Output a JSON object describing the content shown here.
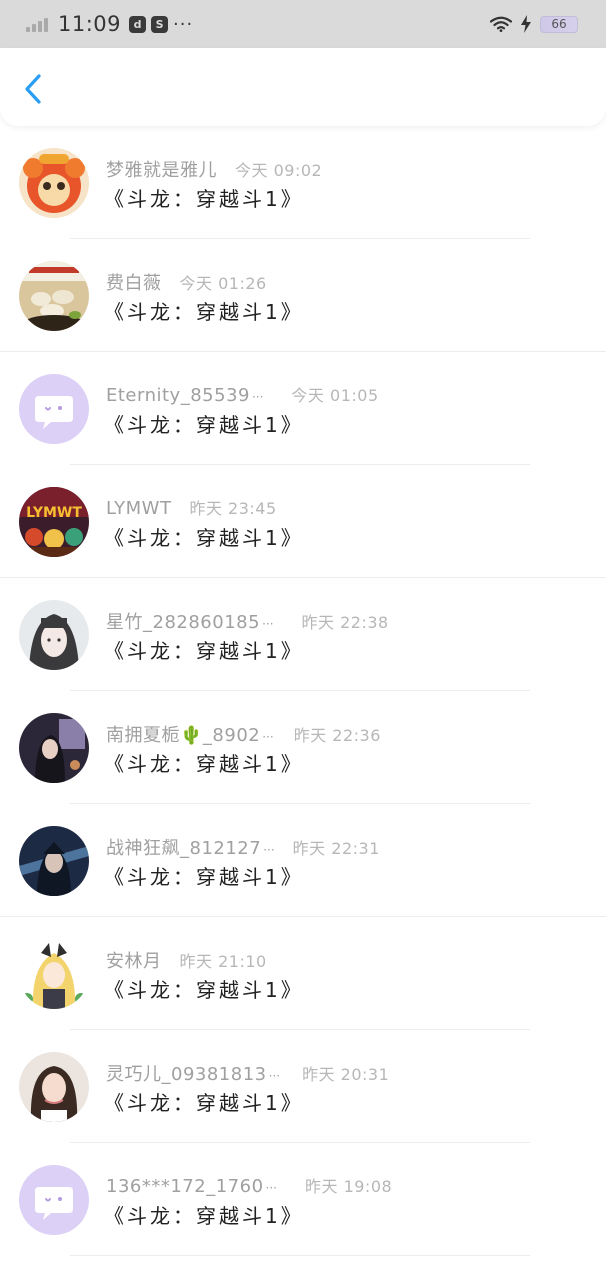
{
  "status_bar": {
    "time": "11:09",
    "icon_a": "d",
    "icon_b": "S",
    "more": "···",
    "battery": "66"
  },
  "header": {
    "back_icon": "chevron-left-icon"
  },
  "accent_color": "#2a9df4",
  "rows": [
    {
      "name": "梦雅就是雅儿",
      "truncated": "",
      "time": "今天 09:02",
      "book": "《斗龙：穿越斗1》",
      "avatar": "orange"
    },
    {
      "name": "费白薇",
      "truncated": "",
      "time": "今天 01:26",
      "book": "《斗龙：穿越斗1》",
      "avatar": "food"
    },
    {
      "name": "Eternity_85539",
      "truncated": "···",
      "time": "今天 01:05",
      "book": "《斗龙：穿越斗1》",
      "avatar": "default"
    },
    {
      "name": "LYMWT",
      "truncated": "",
      "time": "昨天 23:45",
      "book": "《斗龙：穿越斗1》",
      "avatar": "game"
    },
    {
      "name": "星竹_282860185",
      "truncated": "···",
      "time": "昨天 22:38",
      "book": "《斗龙：穿越斗1》",
      "avatar": "girl"
    },
    {
      "name": "南拥夏栀🌵_8902",
      "truncated": "···",
      "time": "昨天 22:36",
      "book": "《斗龙：穿越斗1》",
      "avatar": "night"
    },
    {
      "name": "战神狂飙_812127",
      "truncated": "···",
      "time": "昨天 22:31",
      "book": "《斗龙：穿越斗1》",
      "avatar": "warrior"
    },
    {
      "name": "安林月",
      "truncated": "",
      "time": "昨天 21:10",
      "book": "《斗龙：穿越斗1》",
      "avatar": "anime"
    },
    {
      "name": "灵巧儿_09381813",
      "truncated": "···",
      "time": "昨天 20:31",
      "book": "《斗龙：穿越斗1》",
      "avatar": "woman"
    },
    {
      "name": "136***172_1760",
      "truncated": "···",
      "time": "昨天 19:08",
      "book": "《斗龙：穿越斗1》",
      "avatar": "default"
    }
  ]
}
